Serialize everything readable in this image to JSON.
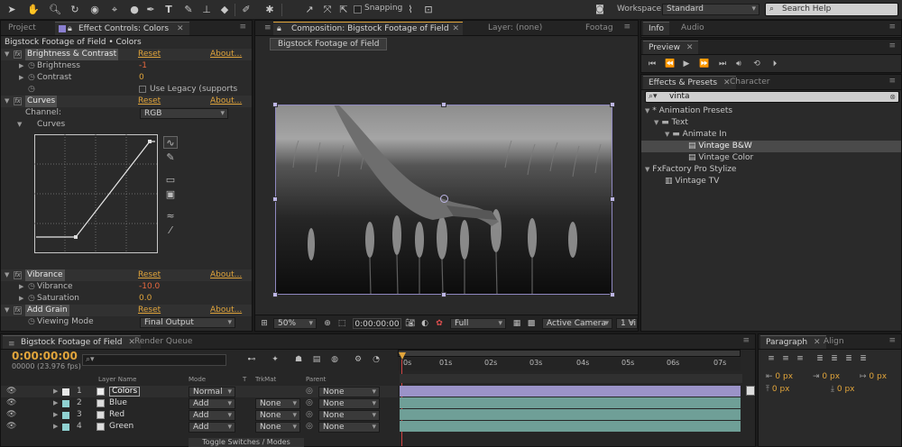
{
  "toolbar": {
    "snapping_label": "Snapping",
    "workspace_label": "Workspace:",
    "workspace_value": "Standard",
    "search_placeholder": "Search Help"
  },
  "left_panel": {
    "tabs": [
      "Project",
      "Effect Controls: Colors"
    ],
    "breadcrumb": "Bigstock Footage of Field • Colors",
    "effects": {
      "brightness": {
        "name": "Brightness & Contrast",
        "reset": "Reset",
        "about": "About...",
        "brightness_label": "Brightness",
        "brightness_value": "-1",
        "contrast_label": "Contrast",
        "contrast_value": "0",
        "legacy_label": "Use Legacy (supports"
      },
      "curves": {
        "name": "Curves",
        "reset": "Reset",
        "about": "About...",
        "channel_label": "Channel:",
        "channel_value": "RGB",
        "curves_label": "Curves"
      },
      "vibrance": {
        "name": "Vibrance",
        "reset": "Reset",
        "about": "About...",
        "vibrance_label": "Vibrance",
        "vibrance_value": "-10.0",
        "saturation_label": "Saturation",
        "saturation_value": "0.0"
      },
      "grain": {
        "name": "Add Grain",
        "reset": "Reset",
        "about": "About...",
        "viewing_label": "Viewing Mode",
        "viewing_value": "Final Output"
      }
    }
  },
  "composition": {
    "tabs": [
      "Composition: Bigstock Footage of Field",
      "Layer: (none)",
      "Footag"
    ],
    "subtab": "Bigstock Footage of Field",
    "footer": {
      "zoom": "50%",
      "timecode": "0:00:00:00",
      "resolution": "Full",
      "camera": "Active Camera",
      "views": "1 Vi"
    }
  },
  "right_panel": {
    "info_tabs": [
      "Info",
      "Audio"
    ],
    "preview_tab": "Preview",
    "effects_tabs": [
      "Effects & Presets",
      "Character"
    ],
    "search_value": "vinta",
    "tree": [
      {
        "label": "* Animation Presets",
        "level": 0,
        "type": "folder-open"
      },
      {
        "label": "Text",
        "level": 1,
        "type": "folder"
      },
      {
        "label": "Animate In",
        "level": 2,
        "type": "folder"
      },
      {
        "label": "Vintage B&W",
        "level": 3,
        "type": "preset",
        "selected": true
      },
      {
        "label": "Vintage Color",
        "level": 3,
        "type": "preset"
      },
      {
        "label": "FxFactory Pro Stylize",
        "level": 0,
        "type": "folder-open"
      },
      {
        "label": "Vintage TV",
        "level": 1,
        "type": "effect"
      }
    ]
  },
  "timeline": {
    "tabs": [
      "Bigstock Footage of Field",
      "Render Queue"
    ],
    "timecode": "0:00:00:00",
    "fps": "00000 (23.976 fps)",
    "columns": {
      "layer_name": "Layer Name",
      "mode": "Mode",
      "t": "T",
      "trkmat": "TrkMat",
      "parent": "Parent"
    },
    "ruler": [
      "0s",
      "01s",
      "02s",
      "03s",
      "04s",
      "05s",
      "06s",
      "07s"
    ],
    "layers": [
      {
        "num": "1",
        "name": "Colors",
        "mode": "Normal",
        "trkmat": "",
        "parent": "None",
        "color": "#e8e8e8"
      },
      {
        "num": "2",
        "name": "Blue",
        "mode": "Add",
        "trkmat": "None",
        "parent": "None",
        "color": "#8fd1d1"
      },
      {
        "num": "3",
        "name": "Red",
        "mode": "Add",
        "trkmat": "None",
        "parent": "None",
        "color": "#8fd1d1"
      },
      {
        "num": "4",
        "name": "Green",
        "mode": "Add",
        "trkmat": "None",
        "parent": "None",
        "color": "#8fd1d1"
      }
    ],
    "footer": "Toggle Switches / Modes"
  },
  "paragraph_panel": {
    "tabs": [
      "Paragraph",
      "Align"
    ],
    "values": [
      "0 px",
      "0 px",
      "0 px",
      "0 px",
      "0 px"
    ]
  }
}
